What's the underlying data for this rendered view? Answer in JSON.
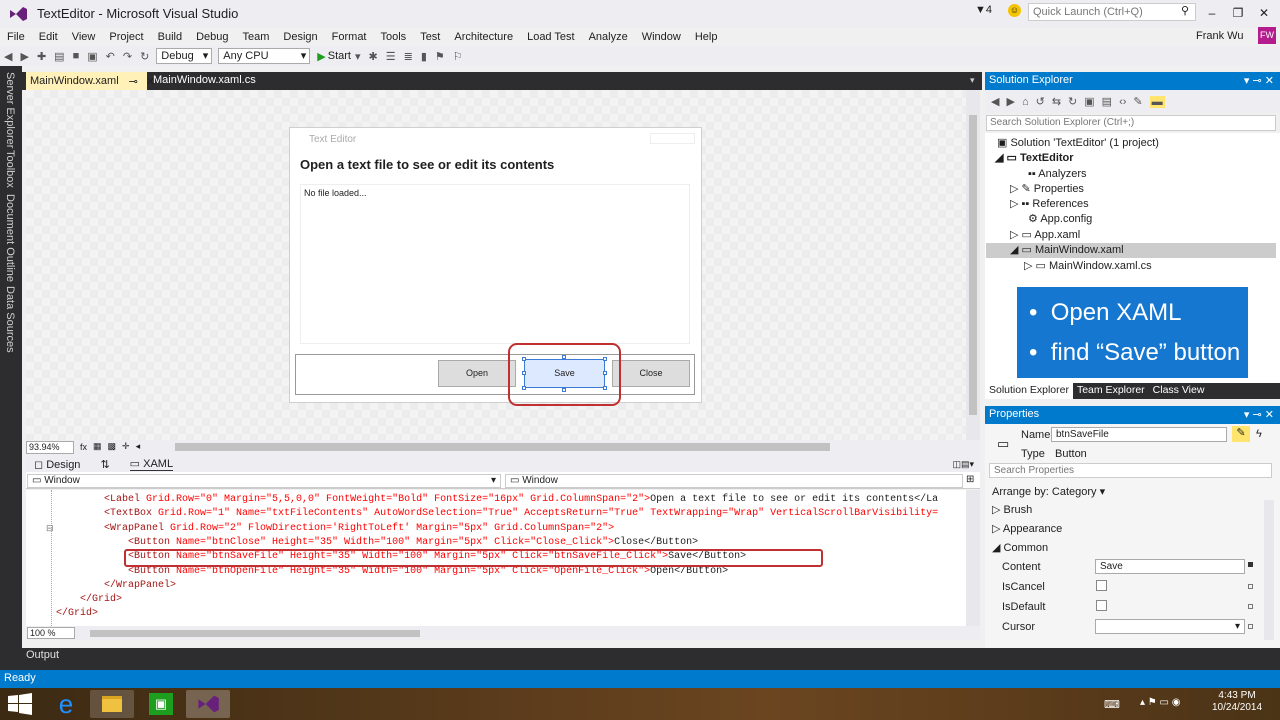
{
  "window": {
    "title": "TextEditor - Microsoft Visual Studio",
    "notifications": "4",
    "quick_launch": "Quick Launch (Ctrl+Q)",
    "user": "Frank Wu",
    "user_initials": "FW"
  },
  "menu": [
    "File",
    "Edit",
    "View",
    "Project",
    "Build",
    "Debug",
    "Team",
    "Design",
    "Format",
    "Tools",
    "Test",
    "Architecture",
    "Load Test",
    "Analyze",
    "Window",
    "Help"
  ],
  "toolbar": {
    "config": "Debug",
    "platform": "Any CPU",
    "start": "Start"
  },
  "left_tabs": [
    "Server Explorer",
    "Toolbox",
    "Document Outline",
    "Data Sources"
  ],
  "tabs": {
    "active": "MainWindow.xaml",
    "other": "MainWindow.xaml.cs"
  },
  "designer": {
    "window_title": "Text Editor",
    "heading": "Open a text file to see or edit its contents",
    "textbox": "No file loaded...",
    "buttons": {
      "open": "Open",
      "save": "Save",
      "close": "Close"
    }
  },
  "zoom": "93.94%",
  "views": {
    "design": "Design",
    "xaml": "XAML"
  },
  "editor": {
    "left_combo": "Window",
    "right_combo": "Window",
    "zoom": "100 %",
    "lines": [
      {
        "indent": "        ",
        "tag": "<Label",
        "attrs": " Grid.Row=\"0\" Margin=\"5,5,0,0\" FontWeight=\"Bold\" FontSize=\"16px\" Grid.ColumnSpan=\"2\">",
        "text": "Open a text file to see or edit its contents</La"
      },
      {
        "indent": "        ",
        "tag": "<TextBox",
        "attrs": " Grid.Row=\"1\" Name=\"txtFileContents\" AutoWordSelection=\"True\" AcceptsReturn=\"True\" TextWrapping=\"Wrap\" VerticalScrollBarVisibility=",
        "text": ""
      },
      {
        "indent": "        ",
        "tag": "<WrapPanel",
        "attrs": " Grid.Row=\"2\" FlowDirection='RightToLeft' Margin=\"5px\" Grid.ColumnSpan=\"2\">",
        "text": ""
      },
      {
        "indent": "            ",
        "tag": "<Button",
        "attrs": " Name=\"btnClose\" Height=\"35\" Width=\"100\" Margin=\"5px\" Click=\"Close_Click\">",
        "text": "Close</Button>"
      },
      {
        "indent": "            ",
        "tag": "<Button",
        "attrs": " Name=\"btnSaveFile\" Height=\"35\" Width=\"100\" Margin=\"5px\" Click=\"btnSaveFile_Click\">",
        "text": "Save</Button>"
      },
      {
        "indent": "            ",
        "tag": "<Button",
        "attrs": " Name=\"btnOpenFile\" Height=\"35\" Width=\"100\" Margin=\"5px\" Click=\"OpenFile_Click\">",
        "text": "Open</Button>"
      },
      {
        "indent": "        ",
        "tag": "</WrapPanel>",
        "attrs": "",
        "text": ""
      },
      {
        "indent": "    ",
        "tag": "</Grid>",
        "attrs": "",
        "text": ""
      },
      {
        "indent": "",
        "tag": "</Grid>",
        "attrs": "",
        "text": ""
      }
    ]
  },
  "output_label": "Output",
  "status": "Ready",
  "clock": {
    "time": "4:43 PM",
    "date": "10/24/2014"
  },
  "solution_explorer": {
    "title": "Solution Explorer",
    "search": "Search Solution Explorer (Ctrl+;)",
    "items": [
      "Solution 'TextEditor' (1 project)",
      "TextEditor",
      "Analyzers",
      "Properties",
      "References",
      "App.config",
      "App.xaml",
      "MainWindow.xaml",
      "MainWindow.xaml.cs"
    ],
    "callout": [
      "Open XAML",
      "find “Save” button"
    ],
    "tabs": [
      "Solution Explorer",
      "Team Explorer",
      "Class View"
    ]
  },
  "properties": {
    "title": "Properties",
    "name_label": "Name",
    "name_value": "btnSaveFile",
    "type_label": "Type",
    "type_value": "Button",
    "search": "Search Properties",
    "arrange": "Arrange by: Category",
    "categories": [
      "Brush",
      "Appearance",
      "Common"
    ],
    "rows": [
      {
        "label": "Content",
        "value": "Save"
      },
      {
        "label": "IsCancel"
      },
      {
        "label": "IsDefault"
      },
      {
        "label": "Cursor"
      }
    ]
  }
}
